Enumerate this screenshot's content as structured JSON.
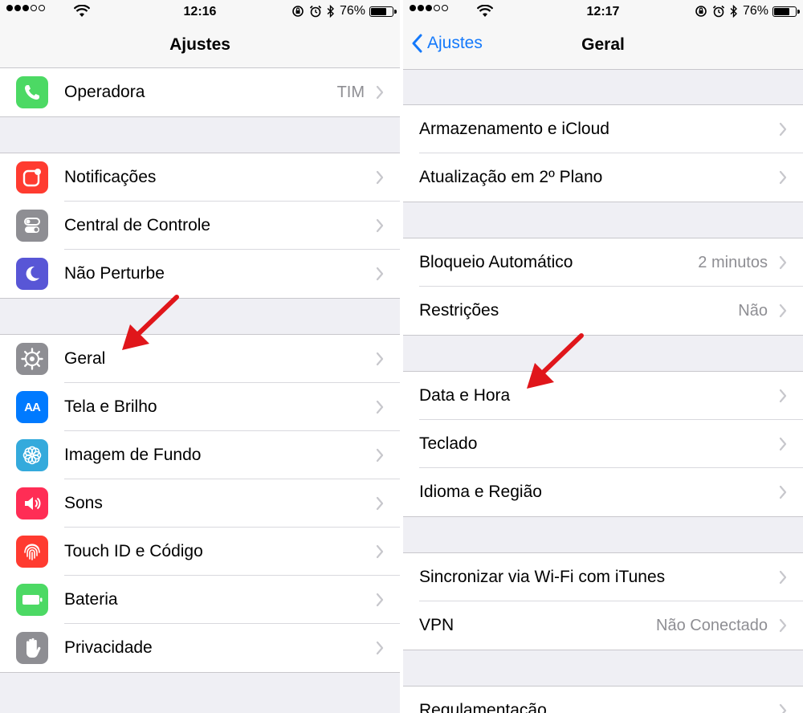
{
  "left": {
    "status": {
      "time": "12:16",
      "battery": "76%",
      "battery_level": 0.76
    },
    "nav": {
      "title": "Ajustes"
    },
    "groups": [
      [
        {
          "label": "Operadora",
          "value": "TIM",
          "icon": "phone-icon",
          "color": "#4cd964"
        }
      ],
      [
        {
          "label": "Notificações",
          "icon": "notifications-icon",
          "color": "#ff3b30"
        },
        {
          "label": "Central de Controle",
          "icon": "toggles-icon",
          "color": "#8e8e93"
        },
        {
          "label": "Não Perturbe",
          "icon": "moon-icon",
          "color": "#5856d6"
        }
      ],
      [
        {
          "label": "Geral",
          "icon": "gear-icon",
          "color": "#8e8e93"
        },
        {
          "label": "Tela e Brilho",
          "icon": "text-size-icon",
          "color": "#007aff",
          "glyph": "AA"
        },
        {
          "label": "Imagem de Fundo",
          "icon": "flower-icon",
          "color": "#34aadc"
        },
        {
          "label": "Sons",
          "icon": "speaker-icon",
          "color": "#ff2d55"
        },
        {
          "label": "Touch ID e Código",
          "icon": "fingerprint-icon",
          "color": "#ff3b30"
        },
        {
          "label": "Bateria",
          "icon": "battery-icon",
          "color": "#4cd964"
        },
        {
          "label": "Privacidade",
          "icon": "hand-icon",
          "color": "#8e8e93"
        }
      ]
    ]
  },
  "right": {
    "status": {
      "time": "12:17",
      "battery": "76%",
      "battery_level": 0.76
    },
    "nav": {
      "title": "Geral",
      "back": "Ajustes"
    },
    "groups": [
      [
        {
          "label": "Armazenamento e iCloud"
        },
        {
          "label": "Atualização em 2º Plano"
        }
      ],
      [
        {
          "label": "Bloqueio Automático",
          "value": "2 minutos"
        },
        {
          "label": "Restrições",
          "value": "Não"
        }
      ],
      [
        {
          "label": "Data e Hora"
        },
        {
          "label": "Teclado"
        },
        {
          "label": "Idioma e Região"
        }
      ],
      [
        {
          "label": "Sincronizar via Wi-Fi com iTunes"
        },
        {
          "label": "VPN",
          "value": "Não Conectado"
        }
      ],
      [
        {
          "label": "Regulamentação"
        }
      ]
    ]
  },
  "colors": {
    "accent": "#1479fb",
    "annotation_arrow": "#e0161b"
  }
}
